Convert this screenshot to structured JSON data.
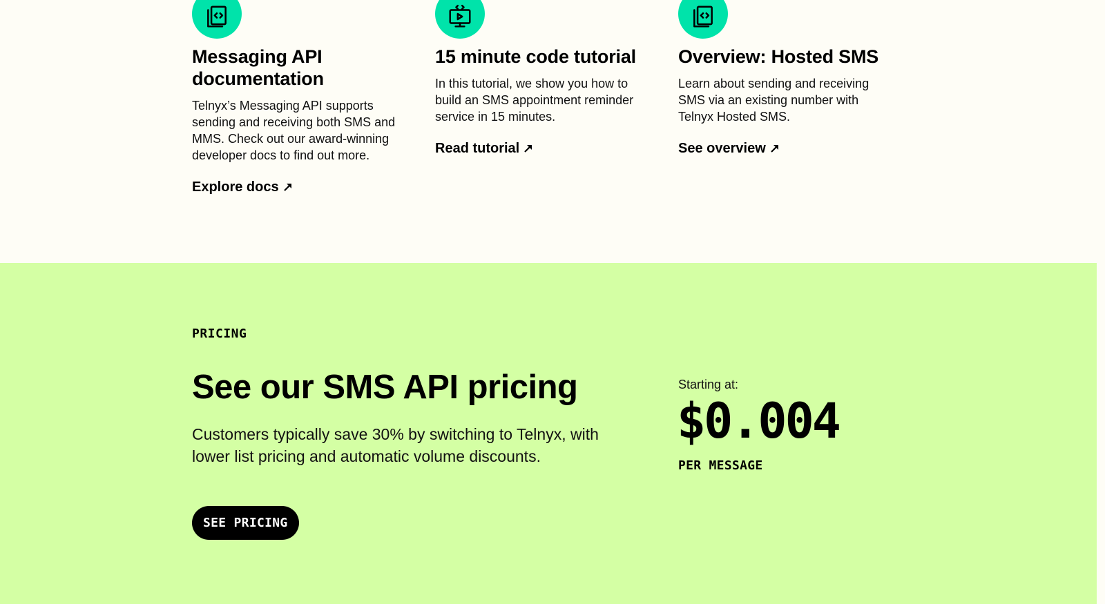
{
  "resources": {
    "cards": [
      {
        "icon": "code-document-icon",
        "title": "Messaging API documentation",
        "description": "Telnyx’s Messaging API supports sending and receiving both SMS and MMS. Check out our award-winning developer docs to find out more.",
        "link_label": "Explore docs"
      },
      {
        "icon": "code-monitor-play-icon",
        "title": "15 minute code tutorial",
        "description": "In this tutorial, we show you how to build an SMS appointment reminder service in 15 minutes.",
        "link_label": "Read tutorial"
      },
      {
        "icon": "code-document-icon",
        "title": "Overview: Hosted SMS",
        "description": "Learn about sending and receiving SMS via an existing number with Telnyx Hosted SMS.",
        "link_label": "See overview"
      }
    ]
  },
  "pricing": {
    "eyebrow": "PRICING",
    "title": "See our SMS API pricing",
    "description": "Customers typically save 30% by switching to Telnyx, with lower list pricing and automatic volume discounts.",
    "cta_label": "SEE PRICING",
    "price_label": "Starting at:",
    "price_value": "$0.004",
    "price_unit": "PER MESSAGE"
  },
  "colors": {
    "background": "#fefdf6",
    "pricing_background": "#d4ffa4",
    "icon_accent": "#00e3aa",
    "cta_background": "#000000"
  }
}
